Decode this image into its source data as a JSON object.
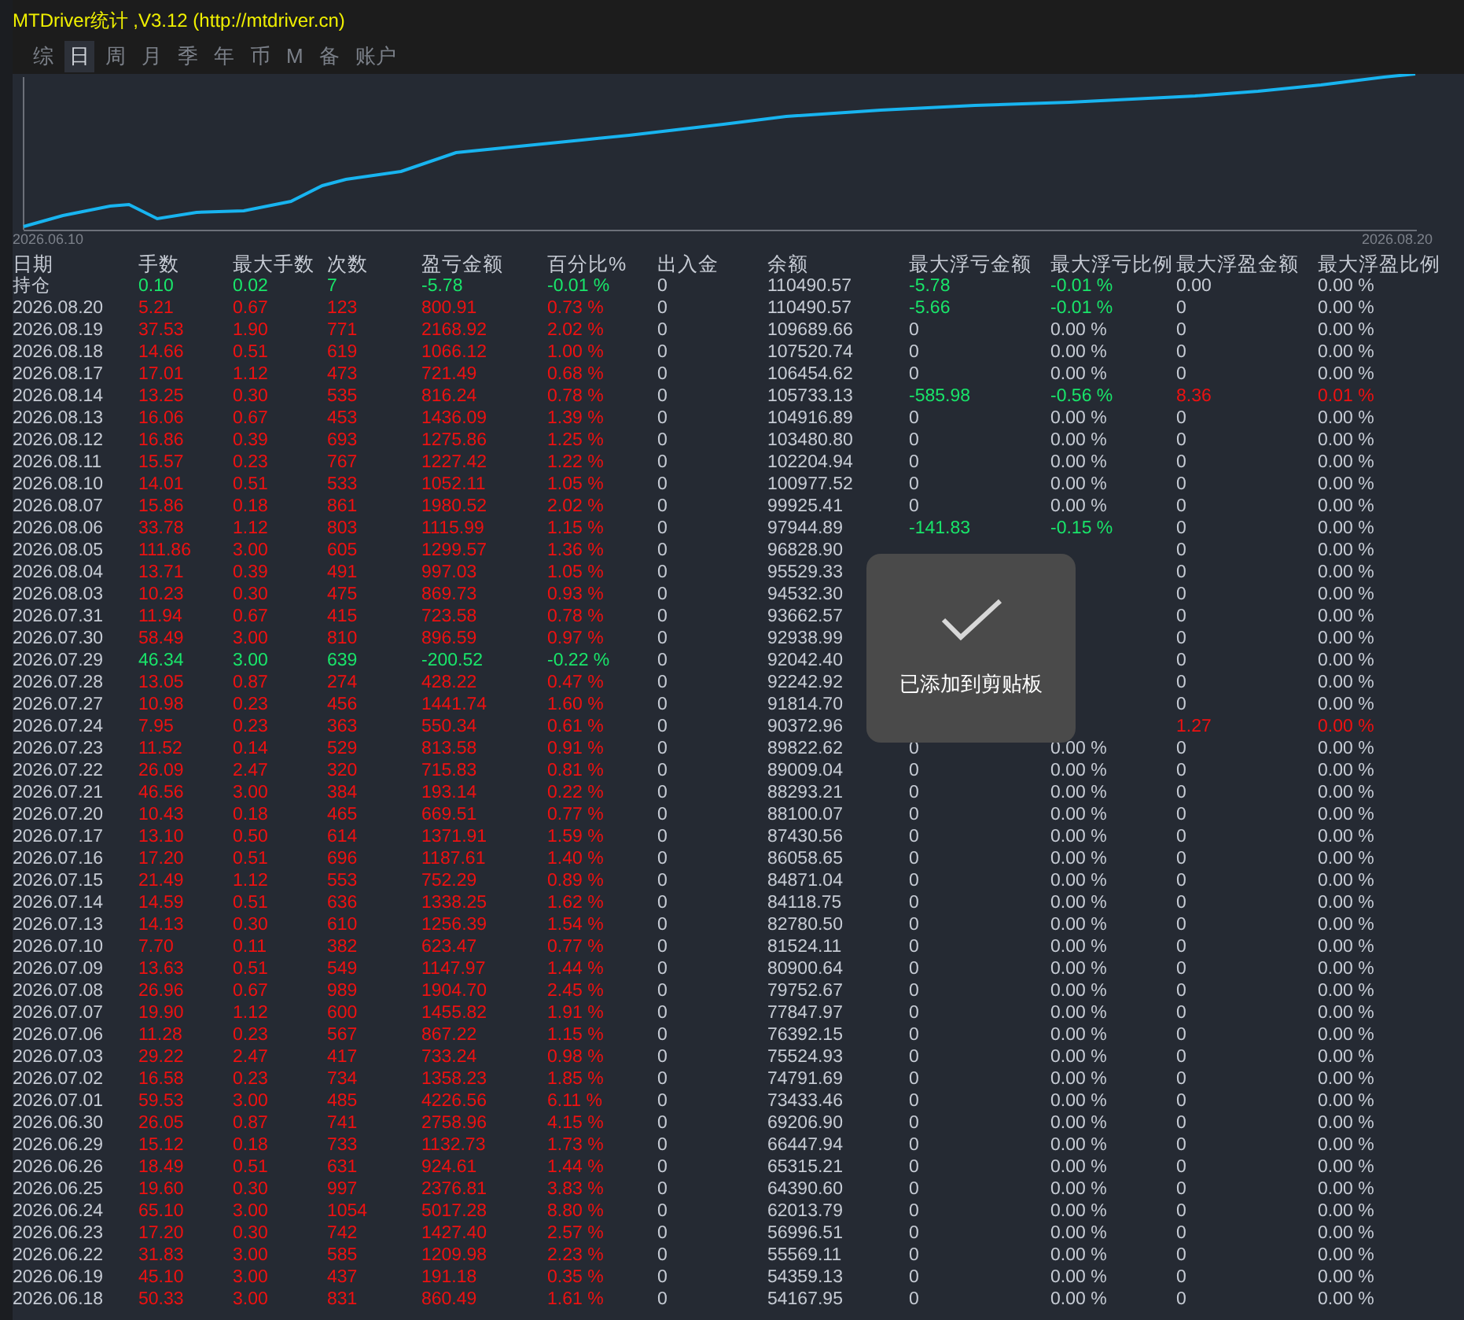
{
  "window": {
    "title": "MTDriver统计 ,V3.12 (http://mtdriver.cn)"
  },
  "tabs": [
    {
      "label": "综",
      "selected": false
    },
    {
      "label": "日",
      "selected": true
    },
    {
      "label": "周",
      "selected": false
    },
    {
      "label": "月",
      "selected": false
    },
    {
      "label": "季",
      "selected": false
    },
    {
      "label": "年",
      "selected": false
    },
    {
      "label": "币",
      "selected": false
    },
    {
      "label": "M",
      "selected": false
    },
    {
      "label": "备",
      "selected": false
    },
    {
      "label": "账户",
      "selected": false
    }
  ],
  "chart": {
    "start_label": "2026.06.10",
    "end_label": "2026.08.20"
  },
  "table": {
    "columns": [
      "日期",
      "手数",
      "最大手数",
      "次数",
      "盈亏金额",
      "百分比%",
      "出入金",
      "余额",
      "最大浮亏金额",
      "最大浮亏比例",
      "最大浮盈金额",
      "最大浮盈比例"
    ],
    "rows": [
      {
        "date": "持仓",
        "loss": true,
        "values": [
          "0.10",
          "0.02",
          "7",
          "-5.78",
          "-0.01 %",
          "0",
          "110490.57"
        ],
        "float_loss": [
          "-5.78",
          "-0.01 %"
        ],
        "float_profit": [
          "0.00",
          "0.00 %"
        ],
        "float_loss_flag": true,
        "float_profit_flag": false
      },
      {
        "date": "2026.08.20",
        "loss": false,
        "values": [
          "5.21",
          "0.67",
          "123",
          "800.91",
          "0.73 %",
          "0",
          "110490.57"
        ],
        "float_loss": [
          "-5.66",
          "-0.01 %"
        ],
        "float_profit": [
          "0",
          "0.00 %"
        ],
        "float_loss_flag": true,
        "float_profit_flag": false
      },
      {
        "date": "2026.08.19",
        "loss": false,
        "values": [
          "37.53",
          "1.90",
          "771",
          "2168.92",
          "2.02 %",
          "0",
          "109689.66"
        ],
        "float_loss": [
          "0",
          "0.00 %"
        ],
        "float_profit": [
          "0",
          "0.00 %"
        ],
        "float_loss_flag": false,
        "float_profit_flag": false
      },
      {
        "date": "2026.08.18",
        "loss": false,
        "values": [
          "14.66",
          "0.51",
          "619",
          "1066.12",
          "1.00 %",
          "0",
          "107520.74"
        ],
        "float_loss": [
          "0",
          "0.00 %"
        ],
        "float_profit": [
          "0",
          "0.00 %"
        ],
        "float_loss_flag": false,
        "float_profit_flag": false
      },
      {
        "date": "2026.08.17",
        "loss": false,
        "values": [
          "17.01",
          "1.12",
          "473",
          "721.49",
          "0.68 %",
          "0",
          "106454.62"
        ],
        "float_loss": [
          "0",
          "0.00 %"
        ],
        "float_profit": [
          "0",
          "0.00 %"
        ],
        "float_loss_flag": false,
        "float_profit_flag": false
      },
      {
        "date": "2026.08.14",
        "loss": false,
        "values": [
          "13.25",
          "0.30",
          "535",
          "816.24",
          "0.78 %",
          "0",
          "105733.13"
        ],
        "float_loss": [
          "-585.98",
          "-0.56 %"
        ],
        "float_profit": [
          "8.36",
          "0.01 %"
        ],
        "float_loss_flag": true,
        "float_profit_flag": true
      },
      {
        "date": "2026.08.13",
        "loss": false,
        "values": [
          "16.06",
          "0.67",
          "453",
          "1436.09",
          "1.39 %",
          "0",
          "104916.89"
        ],
        "float_loss": [
          "0",
          "0.00 %"
        ],
        "float_profit": [
          "0",
          "0.00 %"
        ],
        "float_loss_flag": false,
        "float_profit_flag": false
      },
      {
        "date": "2026.08.12",
        "loss": false,
        "values": [
          "16.86",
          "0.39",
          "693",
          "1275.86",
          "1.25 %",
          "0",
          "103480.80"
        ],
        "float_loss": [
          "0",
          "0.00 %"
        ],
        "float_profit": [
          "0",
          "0.00 %"
        ],
        "float_loss_flag": false,
        "float_profit_flag": false
      },
      {
        "date": "2026.08.11",
        "loss": false,
        "values": [
          "15.57",
          "0.23",
          "767",
          "1227.42",
          "1.22 %",
          "0",
          "102204.94"
        ],
        "float_loss": [
          "0",
          "0.00 %"
        ],
        "float_profit": [
          "0",
          "0.00 %"
        ],
        "float_loss_flag": false,
        "float_profit_flag": false
      },
      {
        "date": "2026.08.10",
        "loss": false,
        "values": [
          "14.01",
          "0.51",
          "533",
          "1052.11",
          "1.05 %",
          "0",
          "100977.52"
        ],
        "float_loss": [
          "0",
          "0.00 %"
        ],
        "float_profit": [
          "0",
          "0.00 %"
        ],
        "float_loss_flag": false,
        "float_profit_flag": false
      },
      {
        "date": "2026.08.07",
        "loss": false,
        "values": [
          "15.86",
          "0.18",
          "861",
          "1980.52",
          "2.02 %",
          "0",
          "99925.41"
        ],
        "float_loss": [
          "0",
          "0.00 %"
        ],
        "float_profit": [
          "0",
          "0.00 %"
        ],
        "float_loss_flag": false,
        "float_profit_flag": false
      },
      {
        "date": "2026.08.06",
        "loss": false,
        "values": [
          "33.78",
          "1.12",
          "803",
          "1115.99",
          "1.15 %",
          "0",
          "97944.89"
        ],
        "float_loss": [
          "-141.83",
          "-0.15 %"
        ],
        "float_profit": [
          "0",
          "0.00 %"
        ],
        "float_loss_flag": true,
        "float_profit_flag": false
      },
      {
        "date": "2026.08.05",
        "loss": false,
        "values": [
          "111.86",
          "3.00",
          "605",
          "1299.57",
          "1.36 %",
          "0",
          "96828.90"
        ],
        "float_profit": [
          "0",
          "0.00 %"
        ],
        "float_profit_flag": false
      },
      {
        "date": "2026.08.04",
        "loss": false,
        "values": [
          "13.71",
          "0.39",
          "491",
          "997.03",
          "1.05 %",
          "0",
          "95529.33"
        ],
        "float_profit": [
          "0",
          "0.00 %"
        ],
        "float_profit_flag": false
      },
      {
        "date": "2026.08.03",
        "loss": false,
        "values": [
          "10.23",
          "0.30",
          "475",
          "869.73",
          "0.93 %",
          "0",
          "94532.30"
        ],
        "float_profit": [
          "0",
          "0.00 %"
        ],
        "float_profit_flag": false
      },
      {
        "date": "2026.07.31",
        "loss": false,
        "values": [
          "11.94",
          "0.67",
          "415",
          "723.58",
          "0.78 %",
          "0",
          "93662.57"
        ],
        "float_profit": [
          "0",
          "0.00 %"
        ],
        "float_profit_flag": false
      },
      {
        "date": "2026.07.30",
        "loss": false,
        "values": [
          "58.49",
          "3.00",
          "810",
          "896.59",
          "0.97 %",
          "0",
          "92938.99"
        ],
        "float_profit": [
          "0",
          "0.00 %"
        ],
        "float_profit_flag": false
      },
      {
        "date": "2026.07.29",
        "loss": true,
        "values": [
          "46.34",
          "3.00",
          "639",
          "-200.52",
          "-0.22 %",
          "0",
          "92042.40"
        ],
        "float_profit": [
          "0",
          "0.00 %"
        ],
        "float_profit_flag": false
      },
      {
        "date": "2026.07.28",
        "loss": false,
        "values": [
          "13.05",
          "0.87",
          "274",
          "428.22",
          "0.47 %",
          "0",
          "92242.92"
        ],
        "float_profit": [
          "0",
          "0.00 %"
        ],
        "float_profit_flag": false
      },
      {
        "date": "2026.07.27",
        "loss": false,
        "values": [
          "10.98",
          "0.23",
          "456",
          "1441.74",
          "1.60 %",
          "0",
          "91814.70"
        ],
        "float_profit": [
          "0",
          "0.00 %"
        ],
        "float_profit_flag": false
      },
      {
        "date": "2026.07.24",
        "loss": false,
        "values": [
          "7.95",
          "0.23",
          "363",
          "550.34",
          "0.61 %",
          "0",
          "90372.96"
        ],
        "float_profit": [
          "1.27",
          "0.00 %"
        ],
        "float_profit_flag": true
      },
      {
        "date": "2026.07.23",
        "loss": false,
        "values": [
          "11.52",
          "0.14",
          "529",
          "813.58",
          "0.91 %",
          "0",
          "89822.62"
        ],
        "float_loss": [
          "0",
          "0.00 %"
        ],
        "float_profit": [
          "0",
          "0.00 %"
        ],
        "float_loss_flag": false,
        "float_profit_flag": false
      },
      {
        "date": "2026.07.22",
        "loss": false,
        "values": [
          "26.09",
          "2.47",
          "320",
          "715.83",
          "0.81 %",
          "0",
          "89009.04"
        ],
        "float_loss": [
          "0",
          "0.00 %"
        ],
        "float_profit": [
          "0",
          "0.00 %"
        ],
        "float_loss_flag": false,
        "float_profit_flag": false
      },
      {
        "date": "2026.07.21",
        "loss": false,
        "values": [
          "46.56",
          "3.00",
          "384",
          "193.14",
          "0.22 %",
          "0",
          "88293.21"
        ],
        "float_loss": [
          "0",
          "0.00 %"
        ],
        "float_profit": [
          "0",
          "0.00 %"
        ],
        "float_loss_flag": false,
        "float_profit_flag": false
      },
      {
        "date": "2026.07.20",
        "loss": false,
        "values": [
          "10.43",
          "0.18",
          "465",
          "669.51",
          "0.77 %",
          "0",
          "88100.07"
        ],
        "float_loss": [
          "0",
          "0.00 %"
        ],
        "float_profit": [
          "0",
          "0.00 %"
        ],
        "float_loss_flag": false,
        "float_profit_flag": false
      },
      {
        "date": "2026.07.17",
        "loss": false,
        "values": [
          "13.10",
          "0.50",
          "614",
          "1371.91",
          "1.59 %",
          "0",
          "87430.56"
        ],
        "float_loss": [
          "0",
          "0.00 %"
        ],
        "float_profit": [
          "0",
          "0.00 %"
        ],
        "float_loss_flag": false,
        "float_profit_flag": false
      },
      {
        "date": "2026.07.16",
        "loss": false,
        "values": [
          "17.20",
          "0.51",
          "696",
          "1187.61",
          "1.40 %",
          "0",
          "86058.65"
        ],
        "float_loss": [
          "0",
          "0.00 %"
        ],
        "float_profit": [
          "0",
          "0.00 %"
        ],
        "float_loss_flag": false,
        "float_profit_flag": false
      },
      {
        "date": "2026.07.15",
        "loss": false,
        "values": [
          "21.49",
          "1.12",
          "553",
          "752.29",
          "0.89 %",
          "0",
          "84871.04"
        ],
        "float_loss": [
          "0",
          "0.00 %"
        ],
        "float_profit": [
          "0",
          "0.00 %"
        ],
        "float_loss_flag": false,
        "float_profit_flag": false
      },
      {
        "date": "2026.07.14",
        "loss": false,
        "values": [
          "14.59",
          "0.51",
          "636",
          "1338.25",
          "1.62 %",
          "0",
          "84118.75"
        ],
        "float_loss": [
          "0",
          "0.00 %"
        ],
        "float_profit": [
          "0",
          "0.00 %"
        ],
        "float_loss_flag": false,
        "float_profit_flag": false
      },
      {
        "date": "2026.07.13",
        "loss": false,
        "values": [
          "14.13",
          "0.30",
          "610",
          "1256.39",
          "1.54 %",
          "0",
          "82780.50"
        ],
        "float_loss": [
          "0",
          "0.00 %"
        ],
        "float_profit": [
          "0",
          "0.00 %"
        ],
        "float_loss_flag": false,
        "float_profit_flag": false
      },
      {
        "date": "2026.07.10",
        "loss": false,
        "values": [
          "7.70",
          "0.11",
          "382",
          "623.47",
          "0.77 %",
          "0",
          "81524.11"
        ],
        "float_loss": [
          "0",
          "0.00 %"
        ],
        "float_profit": [
          "0",
          "0.00 %"
        ],
        "float_loss_flag": false,
        "float_profit_flag": false
      },
      {
        "date": "2026.07.09",
        "loss": false,
        "values": [
          "13.63",
          "0.51",
          "549",
          "1147.97",
          "1.44 %",
          "0",
          "80900.64"
        ],
        "float_loss": [
          "0",
          "0.00 %"
        ],
        "float_profit": [
          "0",
          "0.00 %"
        ],
        "float_loss_flag": false,
        "float_profit_flag": false
      },
      {
        "date": "2026.07.08",
        "loss": false,
        "values": [
          "26.96",
          "0.67",
          "989",
          "1904.70",
          "2.45 %",
          "0",
          "79752.67"
        ],
        "float_loss": [
          "0",
          "0.00 %"
        ],
        "float_profit": [
          "0",
          "0.00 %"
        ],
        "float_loss_flag": false,
        "float_profit_flag": false
      },
      {
        "date": "2026.07.07",
        "loss": false,
        "values": [
          "19.90",
          "1.12",
          "600",
          "1455.82",
          "1.91 %",
          "0",
          "77847.97"
        ],
        "float_loss": [
          "0",
          "0.00 %"
        ],
        "float_profit": [
          "0",
          "0.00 %"
        ],
        "float_loss_flag": false,
        "float_profit_flag": false
      },
      {
        "date": "2026.07.06",
        "loss": false,
        "values": [
          "11.28",
          "0.23",
          "567",
          "867.22",
          "1.15 %",
          "0",
          "76392.15"
        ],
        "float_loss": [
          "0",
          "0.00 %"
        ],
        "float_profit": [
          "0",
          "0.00 %"
        ],
        "float_loss_flag": false,
        "float_profit_flag": false
      },
      {
        "date": "2026.07.03",
        "loss": false,
        "values": [
          "29.22",
          "2.47",
          "417",
          "733.24",
          "0.98 %",
          "0",
          "75524.93"
        ],
        "float_loss": [
          "0",
          "0.00 %"
        ],
        "float_profit": [
          "0",
          "0.00 %"
        ],
        "float_loss_flag": false,
        "float_profit_flag": false
      },
      {
        "date": "2026.07.02",
        "loss": false,
        "values": [
          "16.58",
          "0.23",
          "734",
          "1358.23",
          "1.85 %",
          "0",
          "74791.69"
        ],
        "float_loss": [
          "0",
          "0.00 %"
        ],
        "float_profit": [
          "0",
          "0.00 %"
        ],
        "float_loss_flag": false,
        "float_profit_flag": false
      },
      {
        "date": "2026.07.01",
        "loss": false,
        "values": [
          "59.53",
          "3.00",
          "485",
          "4226.56",
          "6.11 %",
          "0",
          "73433.46"
        ],
        "float_loss": [
          "0",
          "0.00 %"
        ],
        "float_profit": [
          "0",
          "0.00 %"
        ],
        "float_loss_flag": false,
        "float_profit_flag": false
      },
      {
        "date": "2026.06.30",
        "loss": false,
        "values": [
          "26.05",
          "0.87",
          "741",
          "2758.96",
          "4.15 %",
          "0",
          "69206.90"
        ],
        "float_loss": [
          "0",
          "0.00 %"
        ],
        "float_profit": [
          "0",
          "0.00 %"
        ],
        "float_loss_flag": false,
        "float_profit_flag": false
      },
      {
        "date": "2026.06.29",
        "loss": false,
        "values": [
          "15.12",
          "0.18",
          "733",
          "1132.73",
          "1.73 %",
          "0",
          "66447.94"
        ],
        "float_loss": [
          "0",
          "0.00 %"
        ],
        "float_profit": [
          "0",
          "0.00 %"
        ],
        "float_loss_flag": false,
        "float_profit_flag": false
      },
      {
        "date": "2026.06.26",
        "loss": false,
        "values": [
          "18.49",
          "0.51",
          "631",
          "924.61",
          "1.44 %",
          "0",
          "65315.21"
        ],
        "float_loss": [
          "0",
          "0.00 %"
        ],
        "float_profit": [
          "0",
          "0.00 %"
        ],
        "float_loss_flag": false,
        "float_profit_flag": false
      },
      {
        "date": "2026.06.25",
        "loss": false,
        "values": [
          "19.60",
          "0.30",
          "997",
          "2376.81",
          "3.83 %",
          "0",
          "64390.60"
        ],
        "float_loss": [
          "0",
          "0.00 %"
        ],
        "float_profit": [
          "0",
          "0.00 %"
        ],
        "float_loss_flag": false,
        "float_profit_flag": false
      },
      {
        "date": "2026.06.24",
        "loss": false,
        "values": [
          "65.10",
          "3.00",
          "1054",
          "5017.28",
          "8.80 %",
          "0",
          "62013.79"
        ],
        "float_loss": [
          "0",
          "0.00 %"
        ],
        "float_profit": [
          "0",
          "0.00 %"
        ],
        "float_loss_flag": false,
        "float_profit_flag": false
      },
      {
        "date": "2026.06.23",
        "loss": false,
        "values": [
          "17.20",
          "0.30",
          "742",
          "1427.40",
          "2.57 %",
          "0",
          "56996.51"
        ],
        "float_loss": [
          "0",
          "0.00 %"
        ],
        "float_profit": [
          "0",
          "0.00 %"
        ],
        "float_loss_flag": false,
        "float_profit_flag": false
      },
      {
        "date": "2026.06.22",
        "loss": false,
        "values": [
          "31.83",
          "3.00",
          "585",
          "1209.98",
          "2.23 %",
          "0",
          "55569.11"
        ],
        "float_loss": [
          "0",
          "0.00 %"
        ],
        "float_profit": [
          "0",
          "0.00 %"
        ],
        "float_loss_flag": false,
        "float_profit_flag": false
      },
      {
        "date": "2026.06.19",
        "loss": false,
        "values": [
          "45.10",
          "3.00",
          "437",
          "191.18",
          "0.35 %",
          "0",
          "54359.13"
        ],
        "float_loss": [
          "0",
          "0.00 %"
        ],
        "float_profit": [
          "0",
          "0.00 %"
        ],
        "float_loss_flag": false,
        "float_profit_flag": false
      },
      {
        "date": "2026.06.18",
        "loss": false,
        "values": [
          "50.33",
          "3.00",
          "831",
          "860.49",
          "1.61 %",
          "0",
          "54167.95"
        ],
        "float_loss": [
          "0",
          "0.00 %"
        ],
        "float_profit": [
          "0",
          "0.00 %"
        ],
        "float_loss_flag": false,
        "float_profit_flag": false
      }
    ]
  },
  "toast": {
    "message": "已添加到剪贴板"
  }
}
